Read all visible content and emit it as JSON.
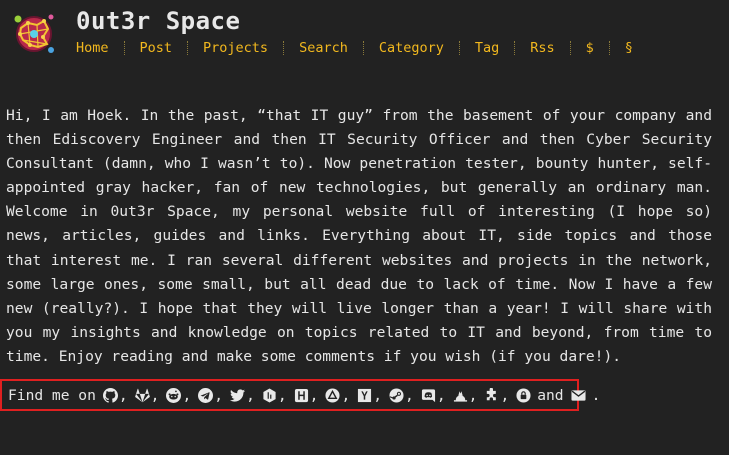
{
  "site": {
    "title": "0ut3r Space"
  },
  "nav": [
    {
      "label": "Home"
    },
    {
      "label": "Post"
    },
    {
      "label": "Projects"
    },
    {
      "label": "Search"
    },
    {
      "label": "Category"
    },
    {
      "label": "Tag"
    },
    {
      "label": "Rss"
    },
    {
      "label": "$"
    },
    {
      "label": "§"
    }
  ],
  "intro": {
    "text": "Hi, I am Hoek. In the past, “that IT guy” from the basement of your company and then Ediscovery Engineer and then IT Security Officer and then Cyber Security Consultant (damn, who I wasn’t to). Now penetration tester, bounty hunter, self-appointed gray hacker, fan of new technologies, but generally an ordinary man. Welcome in 0ut3r Space, my personal website full of interesting (I hope so) news, articles, guides and links. Everything about IT, side topics and those that interest me. I ran several different websites and projects in the network, some large ones, some small, but all dead due to lack of time. Now I have a few new (really?). I hope that they will live longer than a year! I will share with you my insights and knowledge on topics related to IT and beyond, from time to time. Enjoy reading and make some comments if you wish (if you dare!)."
  },
  "find_me": {
    "label": "Find me on",
    "and": "and",
    "comma": ",",
    "end": ".",
    "icons": [
      "github-icon",
      "gitlab-icon",
      "reddit-icon",
      "telegram-icon",
      "twitter-icon",
      "hackerone-icon",
      "hackthebox-icon",
      "tryhackme-icon",
      "ycombinator-icon",
      "steam-icon",
      "discord-icon",
      "codewars-icon",
      "puzzle-icon",
      "lock-icon",
      "envelope-icon"
    ]
  },
  "colors": {
    "background": "#222222",
    "nav_link": "#f2b81e",
    "text": "#e6e6e6",
    "highlight_border": "#e02020"
  }
}
